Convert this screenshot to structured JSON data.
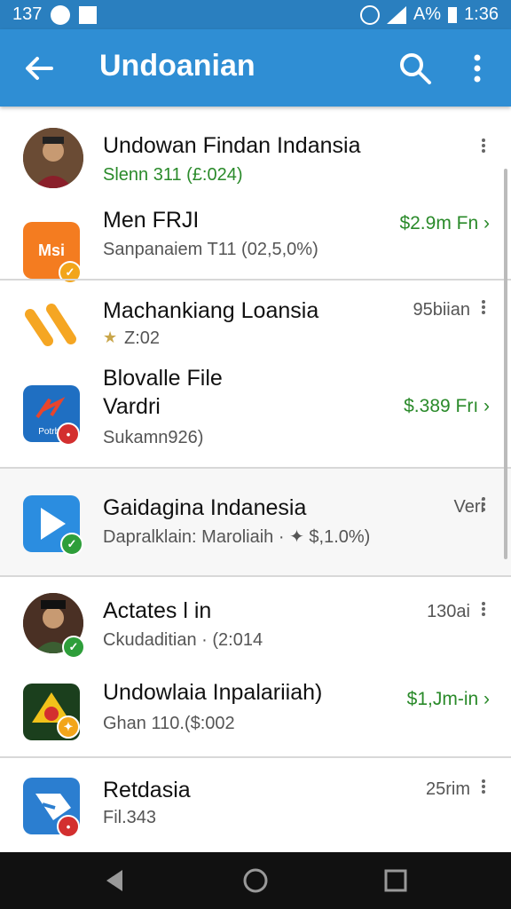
{
  "status": {
    "time_left": "137",
    "time_right": "1:36",
    "battery": "A%"
  },
  "appbar": {
    "title": "Undoanian"
  },
  "items": [
    {
      "title": "Undowan Findan Indansia",
      "sub": "Slenn 311 (£:024)"
    },
    {
      "title": "Men FRJI",
      "sub": "Sanpanaiem T11 (02,5,0%)",
      "price": "$2.9m Fn ›",
      "icon_text": "Msi"
    },
    {
      "title": "Machankiang Loansia",
      "sub": "Z:02",
      "meta": "95biian"
    },
    {
      "title1": "Blovalle File",
      "title2": "Vardri",
      "sub": "Sukamn926)",
      "price": "$.389 Frı ›",
      "icon_text": "Potrbu"
    },
    {
      "title": "Gaidagina Indanesia",
      "sub": "Dapralklain: Maroliaih · ✦ $,1.0%)",
      "meta": "Veri"
    },
    {
      "title": "Actates l in",
      "sub": "Ckudaditian · (2:014",
      "meta": "130ai"
    },
    {
      "title": "Undowlaia Inpalariiah)",
      "sub": "Ghan 110.($:002",
      "price": "$1,Jm-in ›"
    },
    {
      "title": "Retdasia",
      "sub": "Fil.343",
      "meta": "25rim"
    }
  ]
}
